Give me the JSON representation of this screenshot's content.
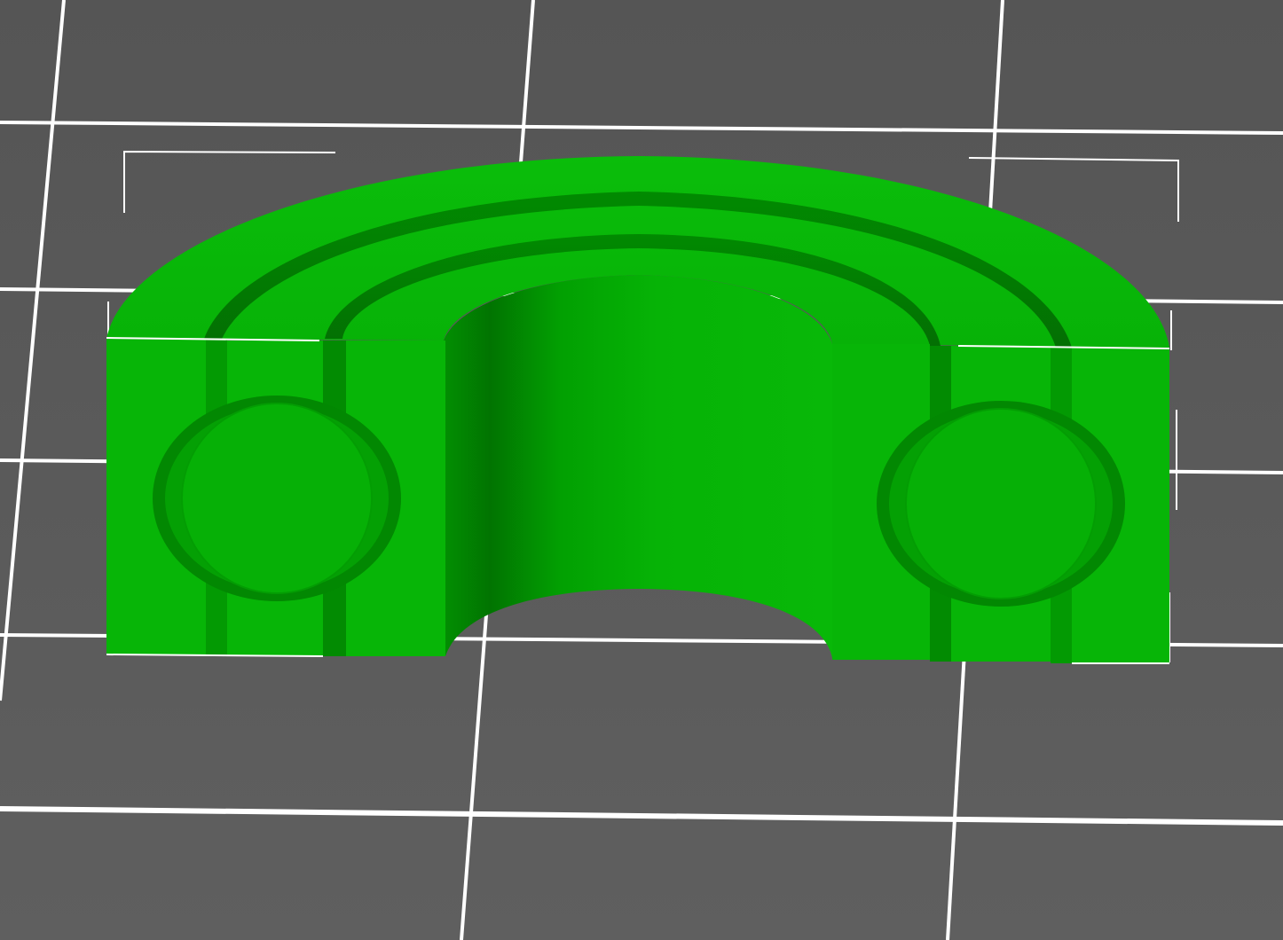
{
  "viewport": {
    "name": "3d-build-plate-view",
    "colors": {
      "background": "#5a5a5a",
      "background_dark": "#505050",
      "grid_line": "#ffffff",
      "model_main": "#06b406",
      "model_light": "#0cc20c",
      "model_dark": "#028a02",
      "model_shadow": "#016d01",
      "selection_box": "#ffffff"
    }
  },
  "model": {
    "name": "ball-bearing-cutaway",
    "state": "selected"
  }
}
